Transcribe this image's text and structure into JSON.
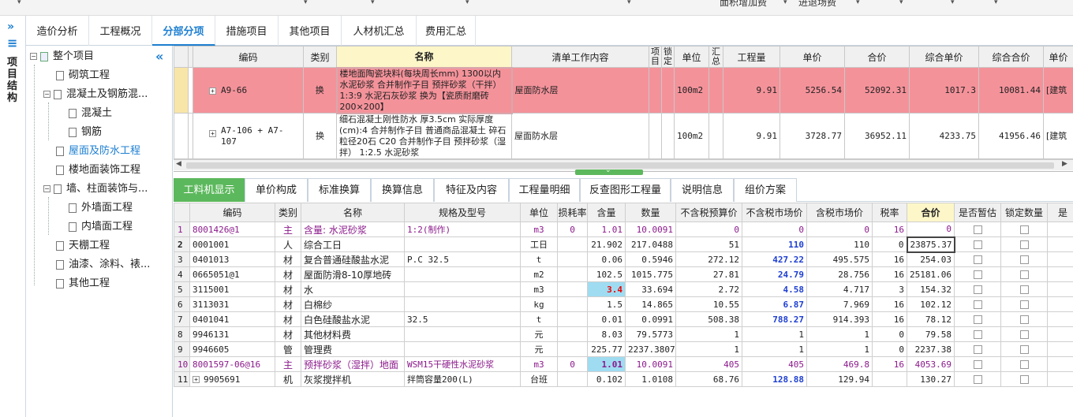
{
  "topbar": {
    "item1": "面积增加费",
    "item2": "进退场费"
  },
  "side": {
    "title": "项目结构"
  },
  "main_tabs": [
    "造价分析",
    "工程概况",
    "分部分项",
    "措施项目",
    "其他项目",
    "人材机汇总",
    "费用汇总"
  ],
  "tree": {
    "root": "整个项目",
    "items": [
      "砌筑工程",
      "混凝土及钢筋混...",
      "混凝土",
      "钢筋",
      "屋面及防水工程",
      "楼地面装饰工程",
      "墙、柱面装饰与...",
      "外墙面工程",
      "内墙面工程",
      "天棚工程",
      "油漆、涂料、裱...",
      "其他工程"
    ]
  },
  "upper_table": {
    "headers": [
      "编码",
      "类别",
      "名称",
      "清单工作内容",
      "项目",
      "锁定",
      "单位",
      "汇总",
      "工程量",
      "单价",
      "合价",
      "综合单价",
      "综合合价",
      "单价"
    ],
    "rows": [
      {
        "code": "A9-66",
        "type": "换",
        "name": "楼地面陶瓷块料(每块周长mm) 1300以内 水泥砂浆  合并制作子目  预拌砂浆（干拌） 1:3:9 水泥石灰砂浆  换为【瓷质耐磨砖200×200】",
        "work": "屋面防水层",
        "unit": "100m2",
        "qty": "9.91",
        "price": "5256.54",
        "total": "52092.31",
        "cprice": "1017.3",
        "ctotal": "10081.44",
        "ext": "[建筑"
      },
      {
        "code": "A7-106 + A7-107",
        "type": "换",
        "name": "细石混凝土刚性防水 厚3.5cm  实际厚度(cm):4  合并制作子目  普通商品混凝土 碎石粒径20石 C20  合并制作子目  预拌砂浆（湿拌） 1:2.5 水泥砂浆",
        "work": "屋面防水层",
        "unit": "100m2",
        "qty": "9.91",
        "price": "3728.77",
        "total": "36952.11",
        "cprice": "4233.75",
        "ctotal": "41956.46",
        "ext": "[建筑"
      }
    ]
  },
  "lower_tabs": [
    "工料机显示",
    "单价构成",
    "标准换算",
    "换算信息",
    "特征及内容",
    "工程量明细",
    "反查图形工程量",
    "说明信息",
    "组价方案"
  ],
  "lower_table": {
    "headers": [
      "编码",
      "类别",
      "名称",
      "规格及型号",
      "单位",
      "损耗率",
      "含量",
      "数量",
      "不含税预算价",
      "不含税市场价",
      "含税市场价",
      "税率",
      "合价",
      "是否暂估",
      "锁定数量",
      "是"
    ],
    "rows": [
      {
        "n": "1",
        "code": "8001426@1",
        "type": "主",
        "name": "含量: 水泥砂浆",
        "spec": "1:2(制作)",
        "unit": "m3",
        "loss": "0",
        "amt": "1.01",
        "qty": "10.0091",
        "bp": "0",
        "mp": "0",
        "tmp": "0",
        "tax": "16",
        "total": "0"
      },
      {
        "n": "2",
        "code": "0001001",
        "type": "人",
        "name": "综合工日",
        "spec": "",
        "unit": "工日",
        "loss": "",
        "amt": "21.902",
        "qty": "217.0488",
        "bp": "51",
        "mp": "110",
        "tmp": "110",
        "tax": "0",
        "total": "23875.37"
      },
      {
        "n": "3",
        "code": "0401013",
        "type": "材",
        "name": "复合普通硅酸盐水泥",
        "spec": "P.C 32.5",
        "unit": "t",
        "loss": "",
        "amt": "0.06",
        "qty": "0.5946",
        "bp": "272.12",
        "mp": "427.22",
        "tmp": "495.575",
        "tax": "16",
        "total": "254.03"
      },
      {
        "n": "4",
        "code": "0665051@1",
        "type": "材",
        "name": "屋面防滑8-10厚地砖",
        "spec": "",
        "unit": "m2",
        "loss": "",
        "amt": "102.5",
        "qty": "1015.775",
        "bp": "27.81",
        "mp": "24.79",
        "tmp": "28.756",
        "tax": "16",
        "total": "25181.06"
      },
      {
        "n": "5",
        "code": "3115001",
        "type": "材",
        "name": "水",
        "spec": "",
        "unit": "m3",
        "loss": "",
        "amt": "3.4",
        "qty": "33.694",
        "bp": "2.72",
        "mp": "4.58",
        "tmp": "4.717",
        "tax": "3",
        "total": "154.32"
      },
      {
        "n": "6",
        "code": "3113031",
        "type": "材",
        "name": "白棉纱",
        "spec": "",
        "unit": "kg",
        "loss": "",
        "amt": "1.5",
        "qty": "14.865",
        "bp": "10.55",
        "mp": "6.87",
        "tmp": "7.969",
        "tax": "16",
        "total": "102.12"
      },
      {
        "n": "7",
        "code": "0401041",
        "type": "材",
        "name": "白色硅酸盐水泥",
        "spec": "32.5",
        "unit": "t",
        "loss": "",
        "amt": "0.01",
        "qty": "0.0991",
        "bp": "508.38",
        "mp": "788.27",
        "tmp": "914.393",
        "tax": "16",
        "total": "78.12"
      },
      {
        "n": "8",
        "code": "9946131",
        "type": "材",
        "name": "其他材料费",
        "spec": "",
        "unit": "元",
        "loss": "",
        "amt": "8.03",
        "qty": "79.5773",
        "bp": "1",
        "mp": "1",
        "tmp": "1",
        "tax": "0",
        "total": "79.58"
      },
      {
        "n": "9",
        "code": "9946605",
        "type": "管",
        "name": "管理费",
        "spec": "",
        "unit": "元",
        "loss": "",
        "amt": "225.77",
        "qty": "2237.3807",
        "bp": "1",
        "mp": "1",
        "tmp": "1",
        "tax": "0",
        "total": "2237.38"
      },
      {
        "n": "10",
        "code": "8001597-06@16",
        "type": "主",
        "name": "预拌砂浆（湿拌）地面",
        "spec": "WSM15干硬性水泥砂浆",
        "unit": "m3",
        "loss": "0",
        "amt": "1.01",
        "qty": "10.0091",
        "bp": "405",
        "mp": "405",
        "tmp": "469.8",
        "tax": "16",
        "total": "4053.69"
      },
      {
        "n": "11",
        "code": "9905691",
        "type": "机",
        "name": "灰浆搅拌机",
        "spec": "拌筒容量200(L)",
        "unit": "台班",
        "loss": "",
        "amt": "0.102",
        "qty": "1.0108",
        "bp": "68.76",
        "mp": "128.88",
        "tmp": "129.94",
        "tax": "",
        "total": "130.27"
      }
    ]
  }
}
